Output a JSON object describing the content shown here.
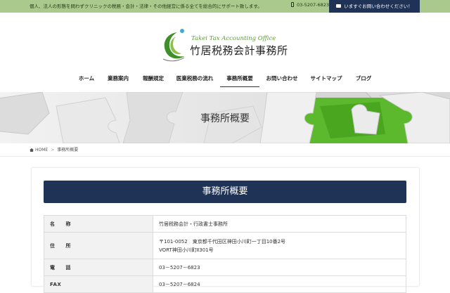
{
  "topbar": {
    "tagline": "個人、法人の形態を問わずクリニックの税務・会計・法律・その他経営に係る全てを総合的にサポート致します。",
    "phone": "03-5207-6823",
    "contact_label": "いますぐお問い合わせください！",
    "bg_color": "#a9c98d",
    "contact_color": "#1f3356"
  },
  "logo": {
    "en": "Takei Tax Accounting Office",
    "jp": "竹居税務会計事務所",
    "icon": "green-crescent-logo-icon"
  },
  "nav": {
    "items": [
      {
        "label": "ホーム"
      },
      {
        "label": "業務案内"
      },
      {
        "label": "報酬規定"
      },
      {
        "label": "医業税務の流れ"
      },
      {
        "label": "事務所概要",
        "active": true
      },
      {
        "label": "お問い合わせ"
      },
      {
        "label": "サイトマップ"
      },
      {
        "label": "ブログ"
      }
    ]
  },
  "hero": {
    "title": "事務所概要",
    "accent_color": "#5cb82c"
  },
  "breadcrumb": {
    "home": "HOME",
    "current": "事務所概要"
  },
  "main": {
    "section_title": "事務所概要",
    "table": [
      {
        "label": "名　　称",
        "lines": [
          "竹居税務会計・行政書士事務所"
        ]
      },
      {
        "label": "住　　所",
        "lines": [
          "〒101-0052　東京都千代田区神田小川町一丁目10番2号",
          "VORT神田小川町Ⅱ301号"
        ]
      },
      {
        "label": "電　　話",
        "lines": [
          "03－5207－6823"
        ]
      },
      {
        "label": "FAX",
        "lines": [
          "03－5207－6824"
        ]
      }
    ]
  }
}
